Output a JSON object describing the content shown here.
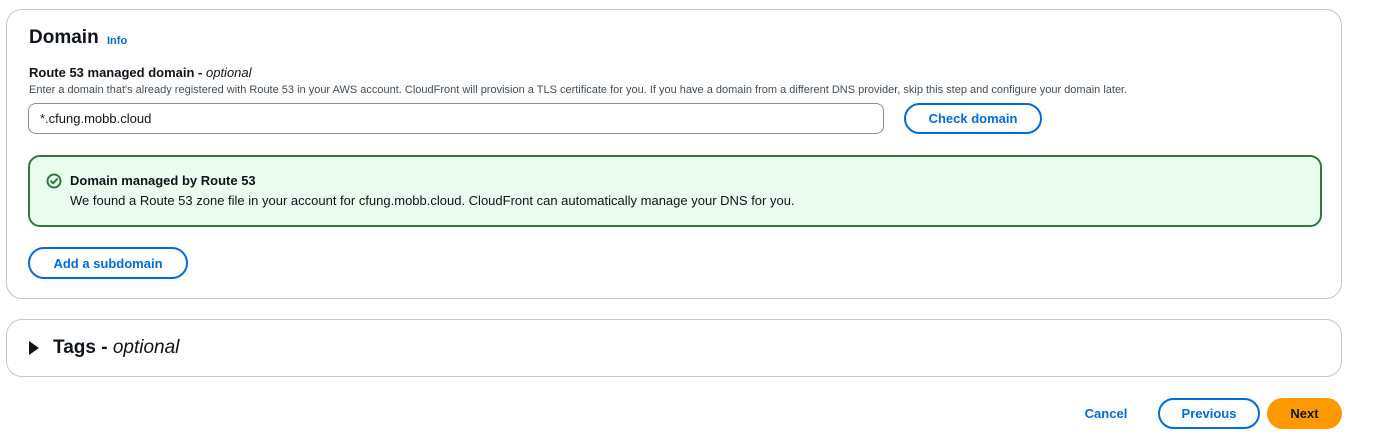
{
  "domain_section": {
    "title": "Domain",
    "info_link": "Info",
    "field_label": "Route 53 managed domain - ",
    "field_label_optional": "optional",
    "field_description": "Enter a domain that's already registered with Route 53 in your AWS account. CloudFront will provision a TLS certificate for you. If you have a domain from a different DNS provider, skip this step and configure your domain later.",
    "input_value": "*.cfung.mobb.cloud",
    "check_domain_label": "Check domain",
    "alert": {
      "title": "Domain managed by Route 53",
      "body": "We found a Route 53 zone file in your account for cfung.mobb.cloud. CloudFront can automatically manage your DNS for you.",
      "icon": "check-circle-icon",
      "color": "#2c7a3b",
      "background": "#ebfdee"
    },
    "add_subdomain_label": "Add a subdomain"
  },
  "tags_section": {
    "title": "Tags - ",
    "title_optional": "optional",
    "expanded": false
  },
  "footer": {
    "cancel_label": "Cancel",
    "previous_label": "Previous",
    "next_label": "Next"
  },
  "colors": {
    "link": "#006ce0",
    "primary_button": "#ff9900"
  }
}
